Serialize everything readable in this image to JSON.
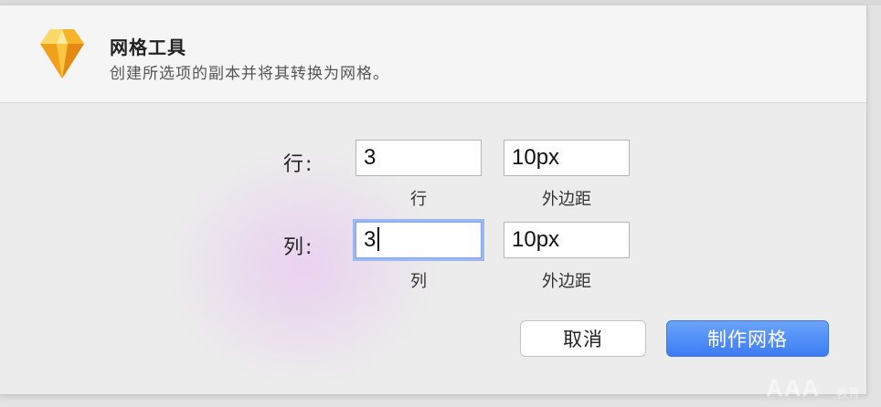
{
  "dialog": {
    "title": "网格工具",
    "subtitle": "创建所选项的副本并将其转换为网格。",
    "icon": "sketch-diamond-icon"
  },
  "rows": {
    "label": "行:",
    "count_value": "3",
    "count_caption": "行",
    "margin_value": "10px",
    "margin_caption": "外边距"
  },
  "columns": {
    "label": "列:",
    "count_value": "3",
    "count_caption": "列",
    "margin_value": "10px",
    "margin_caption": "外边距"
  },
  "buttons": {
    "cancel_label": "取消",
    "confirm_label": "制作网格"
  },
  "watermark": {
    "text": "AAA",
    "subtext": "教育"
  },
  "colors": {
    "primary_button": "#3b7cf3",
    "focus_ring": "#9cb8ef",
    "icon_gold": "#f5b524"
  }
}
